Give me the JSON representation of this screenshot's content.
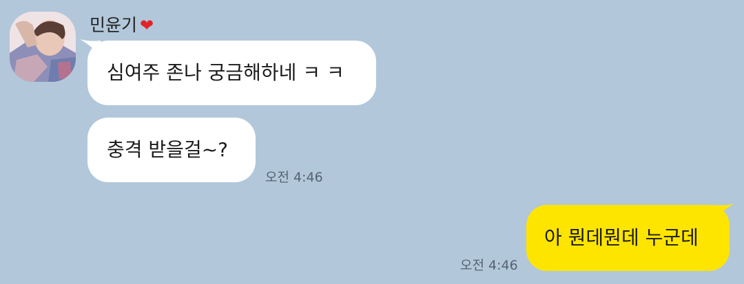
{
  "colors": {
    "background": "#b2c7da",
    "incoming_bubble": "#ffffff",
    "outgoing_bubble": "#fee500",
    "heart": "#e2232a",
    "timestamp": "#556271"
  },
  "sender": {
    "name": "민윤기",
    "emoji": "❤",
    "avatar_icon": "profile-photo"
  },
  "messages": [
    {
      "direction": "incoming",
      "text": "심여주 존나 궁금해하네 ㅋ ㅋ"
    },
    {
      "direction": "incoming",
      "text": "충격 받을걸~?",
      "time": "오전 4:46"
    },
    {
      "direction": "outgoing",
      "text": "아 뭔데뭔데 누군데",
      "time": "오전 4:46"
    }
  ]
}
